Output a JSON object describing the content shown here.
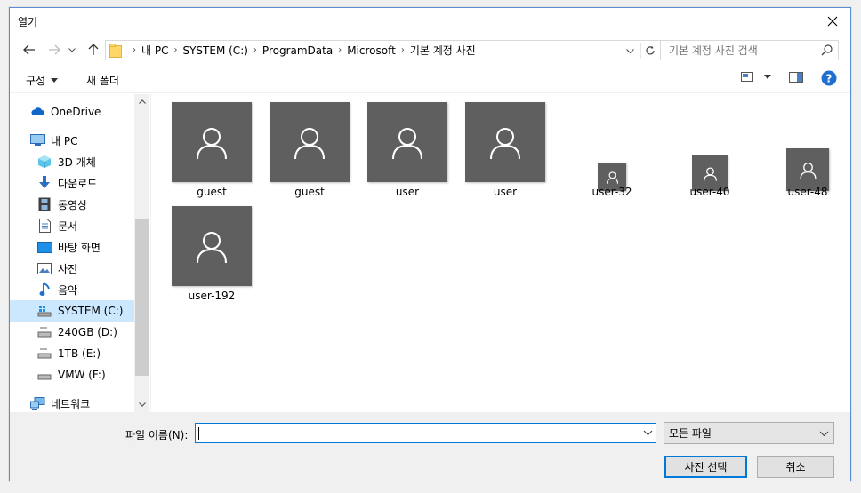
{
  "window": {
    "title": "열기"
  },
  "address": {
    "crumbs": [
      "내 PC",
      "SYSTEM (C:)",
      "ProgramData",
      "Microsoft",
      "기본 계정 사진"
    ],
    "search_placeholder": "기본 계정 사진 검색"
  },
  "toolbar": {
    "organize_label": "구성",
    "new_folder_label": "새 폴더"
  },
  "sidebar": {
    "items": [
      {
        "label": "OneDrive",
        "icon": "cloud-icon"
      },
      {
        "label": "내 PC",
        "icon": "computer-icon"
      },
      {
        "label": "3D 개체",
        "icon": "cube-icon"
      },
      {
        "label": "다운로드",
        "icon": "download-arrow-icon"
      },
      {
        "label": "동영상",
        "icon": "film-icon"
      },
      {
        "label": "문서",
        "icon": "document-icon"
      },
      {
        "label": "바탕 화면",
        "icon": "desktop-icon"
      },
      {
        "label": "사진",
        "icon": "picture-icon"
      },
      {
        "label": "음악",
        "icon": "music-note-icon"
      },
      {
        "label": "SYSTEM (C:)",
        "icon": "windows-drive-icon"
      },
      {
        "label": "240GB (D:)",
        "icon": "drive-icon"
      },
      {
        "label": "1TB (E:)",
        "icon": "drive-icon"
      },
      {
        "label": "VMW (F:)",
        "icon": "drive-icon"
      },
      {
        "label": "네트워크",
        "icon": "network-icon"
      }
    ]
  },
  "files": [
    {
      "name": "guest"
    },
    {
      "name": "guest"
    },
    {
      "name": "user"
    },
    {
      "name": "user"
    },
    {
      "name": "user-32"
    },
    {
      "name": "user-40"
    },
    {
      "name": "user-48"
    },
    {
      "name": "user-192"
    }
  ],
  "bottom": {
    "filename_label": "파일 이름(N):",
    "filename_value": "",
    "filetype_value": "모든 파일",
    "open_button": "사진 선택",
    "cancel_button": "취소"
  },
  "colors": {
    "accent": "#0078d7",
    "selected": "#cce8ff",
    "thumb": "#5f5f5f"
  }
}
